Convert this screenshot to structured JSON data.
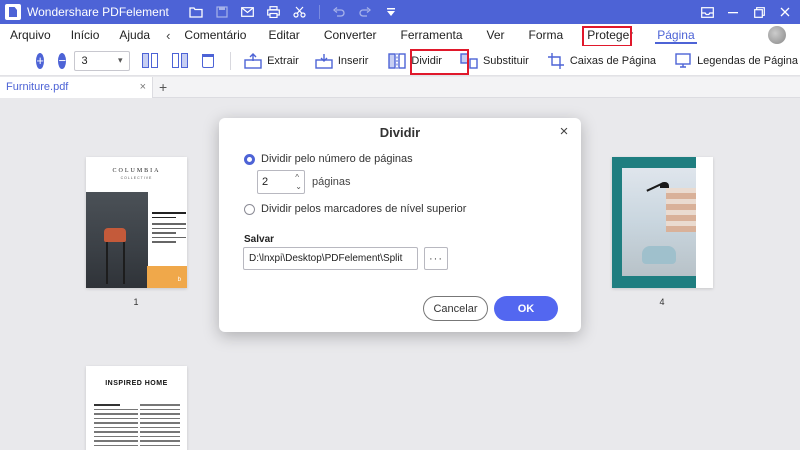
{
  "app": {
    "title": "Wondershare PDFelement"
  },
  "menubar": {
    "items": [
      "Arquivo",
      "Início",
      "Ajuda",
      "Comentário",
      "Editar",
      "Converter",
      "Ferramenta",
      "Ver",
      "Forma",
      "Proteger",
      "Página"
    ],
    "active": "Página"
  },
  "toolbar": {
    "page_input_value": "3",
    "buttons": {
      "extrair": "Extrair",
      "inserir": "Inserir",
      "dividir": "Dividir",
      "substituir": "Substituir",
      "caixas": "Caixas de Página",
      "legendas": "Legendas de Página"
    }
  },
  "tabs": {
    "document": "Furniture.pdf",
    "close_symbol": "×",
    "add_symbol": "+"
  },
  "pages": {
    "page1": {
      "number": "1",
      "title": "COLUMBIA",
      "subtitle": "COLLECTIVE"
    },
    "page4": {
      "number": "4"
    },
    "page5": {
      "title": "INSPIRED HOME"
    }
  },
  "dialog": {
    "title": "Dividir",
    "close_symbol": "×",
    "option_pages_label": "Dividir pelo número de páginas",
    "page_count_value": "2",
    "page_count_unit": "páginas",
    "option_bookmarks_label": "Dividir pelos marcadores de nível superior",
    "save_label": "Salvar",
    "save_path": "D:\\lnxpi\\Desktop\\PDFelement\\Split",
    "browse_label": "···",
    "cancel_label": "Cancelar",
    "ok_label": "OK"
  },
  "colors": {
    "accent": "#4d63d6",
    "highlight": "#e0182b",
    "ok_button": "#5367f0"
  }
}
